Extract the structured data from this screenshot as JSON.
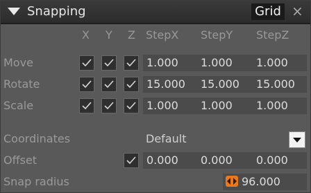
{
  "panel": {
    "title": "Snapping",
    "grid_tab": "Grid",
    "close_glyph": "×"
  },
  "headers": [
    "X",
    "Y",
    "Z",
    "StepX",
    "StepY",
    "StepZ"
  ],
  "rows": [
    {
      "label": "Move",
      "x": true,
      "y": true,
      "z": true,
      "step_x": "1.000",
      "step_y": "1.000",
      "step_z": "1.000"
    },
    {
      "label": "Rotate",
      "x": true,
      "y": true,
      "z": true,
      "step_x": "15.000",
      "step_y": "15.000",
      "step_z": "15.000"
    },
    {
      "label": "Scale",
      "x": true,
      "y": true,
      "z": true,
      "step_x": "1.000",
      "step_y": "1.000",
      "step_z": "1.000"
    }
  ],
  "coordinates": {
    "label": "Coordinates",
    "value": "Default"
  },
  "offset": {
    "label": "Offset",
    "enabled": true,
    "x": "0.000",
    "y": "0.000",
    "z": "0.000"
  },
  "snap_radius": {
    "label": "Snap radius",
    "value": "96.000"
  },
  "icons": {
    "collapse": "collapse-triangle-icon",
    "close": "close-icon",
    "check": "checkmark-icon",
    "dropdown": "chevron-down-icon",
    "spinner": "spinner-arrows-icon"
  },
  "colors": {
    "accent_spinner": "#e8791e",
    "panel_bg": "#595959",
    "field_bg": "#4b4b4b"
  }
}
